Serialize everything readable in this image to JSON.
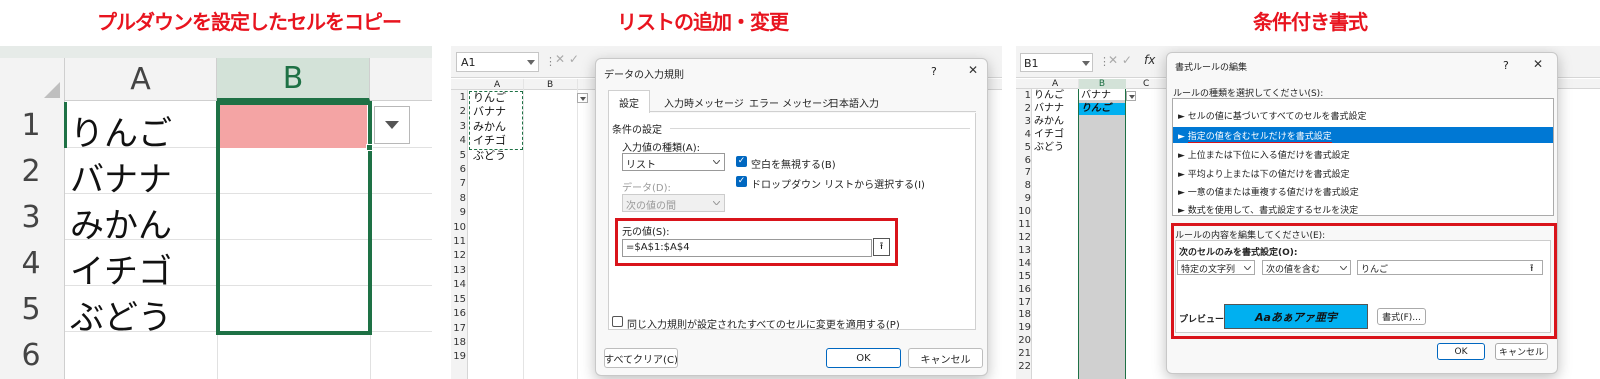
{
  "panels": {
    "p1_title": "プルダウンを設定したセルをコピー",
    "p2_title": "リストの追加・変更",
    "p3_title": "条件付き書式"
  },
  "p1": {
    "columns": [
      "A",
      "B"
    ],
    "rows": [
      "1",
      "2",
      "3",
      "4",
      "5",
      "6"
    ],
    "cells": [
      "りんご",
      "バナナ",
      "みかん",
      "イチゴ",
      "ぶどう"
    ]
  },
  "p2": {
    "namebox": "A1",
    "columns": [
      "A",
      "B"
    ],
    "rows": [
      "1",
      "2",
      "3",
      "4",
      "5",
      "6",
      "7",
      "8",
      "9",
      "10",
      "11",
      "12",
      "13",
      "14",
      "15",
      "16",
      "17",
      "18",
      "19"
    ],
    "cells": [
      "りんご",
      "バナナ",
      "みかん",
      "イチゴ",
      "ぶどう"
    ],
    "dialog": {
      "title": "データの入力規則",
      "help": "?",
      "tabs": [
        "設定",
        "入力時メッセージ",
        "エラー メッセージ",
        "日本語入力"
      ],
      "section": "条件の設定",
      "type_label": "入力値の種類(A):",
      "type_value": "リスト",
      "data_label": "データ(D):",
      "data_value": "次の値の間",
      "ignore_blank": "空白を無視する(B)",
      "dropdown": "ドロップダウン リストから選択する(I)",
      "source_label": "元の値(S):",
      "source_value": "=$A$1:$A$4",
      "apply_all": "同じ入力規則が設定されたすべてのセルに変更を適用する(P)",
      "clear_all": "すべてクリア(C)",
      "ok": "OK",
      "cancel": "キャンセル"
    }
  },
  "p3": {
    "namebox": "B1",
    "fx": "fx",
    "columns": [
      "A",
      "B",
      "C"
    ],
    "rows": [
      "1",
      "2",
      "3",
      "4",
      "5",
      "6",
      "7",
      "8",
      "9",
      "10",
      "11",
      "12",
      "13",
      "14",
      "15",
      "16",
      "17",
      "18",
      "19",
      "20",
      "21",
      "22"
    ],
    "col_a": [
      "りんご",
      "バナナ",
      "みかん",
      "イチゴ",
      "ぶどう"
    ],
    "col_b": [
      "バナナ",
      "りんご"
    ],
    "dialog": {
      "title": "書式ルールの編集",
      "help": "?",
      "rule_type_label": "ルールの種類を選択してください(S):",
      "rule_types": [
        "セルの値に基づいてすべてのセルを書式設定",
        "指定の値を含むセルだけを書式設定",
        "上位または下位に入る値だけを書式設定",
        "平均より上または下の値だけを書式設定",
        "一意の値または重複する値だけを書式設定",
        "数式を使用して、書式設定するセルを決定"
      ],
      "edit_label": "ルールの内容を編集してください(E):",
      "only_label": "次のセルのみを書式設定(O):",
      "cond1": "特定の文字列",
      "cond2": "次の値を含む",
      "cond3": "りんご",
      "preview_label": "プレビュー:",
      "preview_text": "Aaあぁアァ亜宇",
      "format_btn": "書式(F)...",
      "ok": "OK",
      "cancel": "キャンセル"
    }
  },
  "colors": {
    "title_red": "#e8141f",
    "highlight_red": "#d9141b",
    "excel_green": "#1e7145",
    "fill_pink": "#f4a4a4",
    "preview_blue": "#00b0f0",
    "select_blue": "#0078d4"
  }
}
